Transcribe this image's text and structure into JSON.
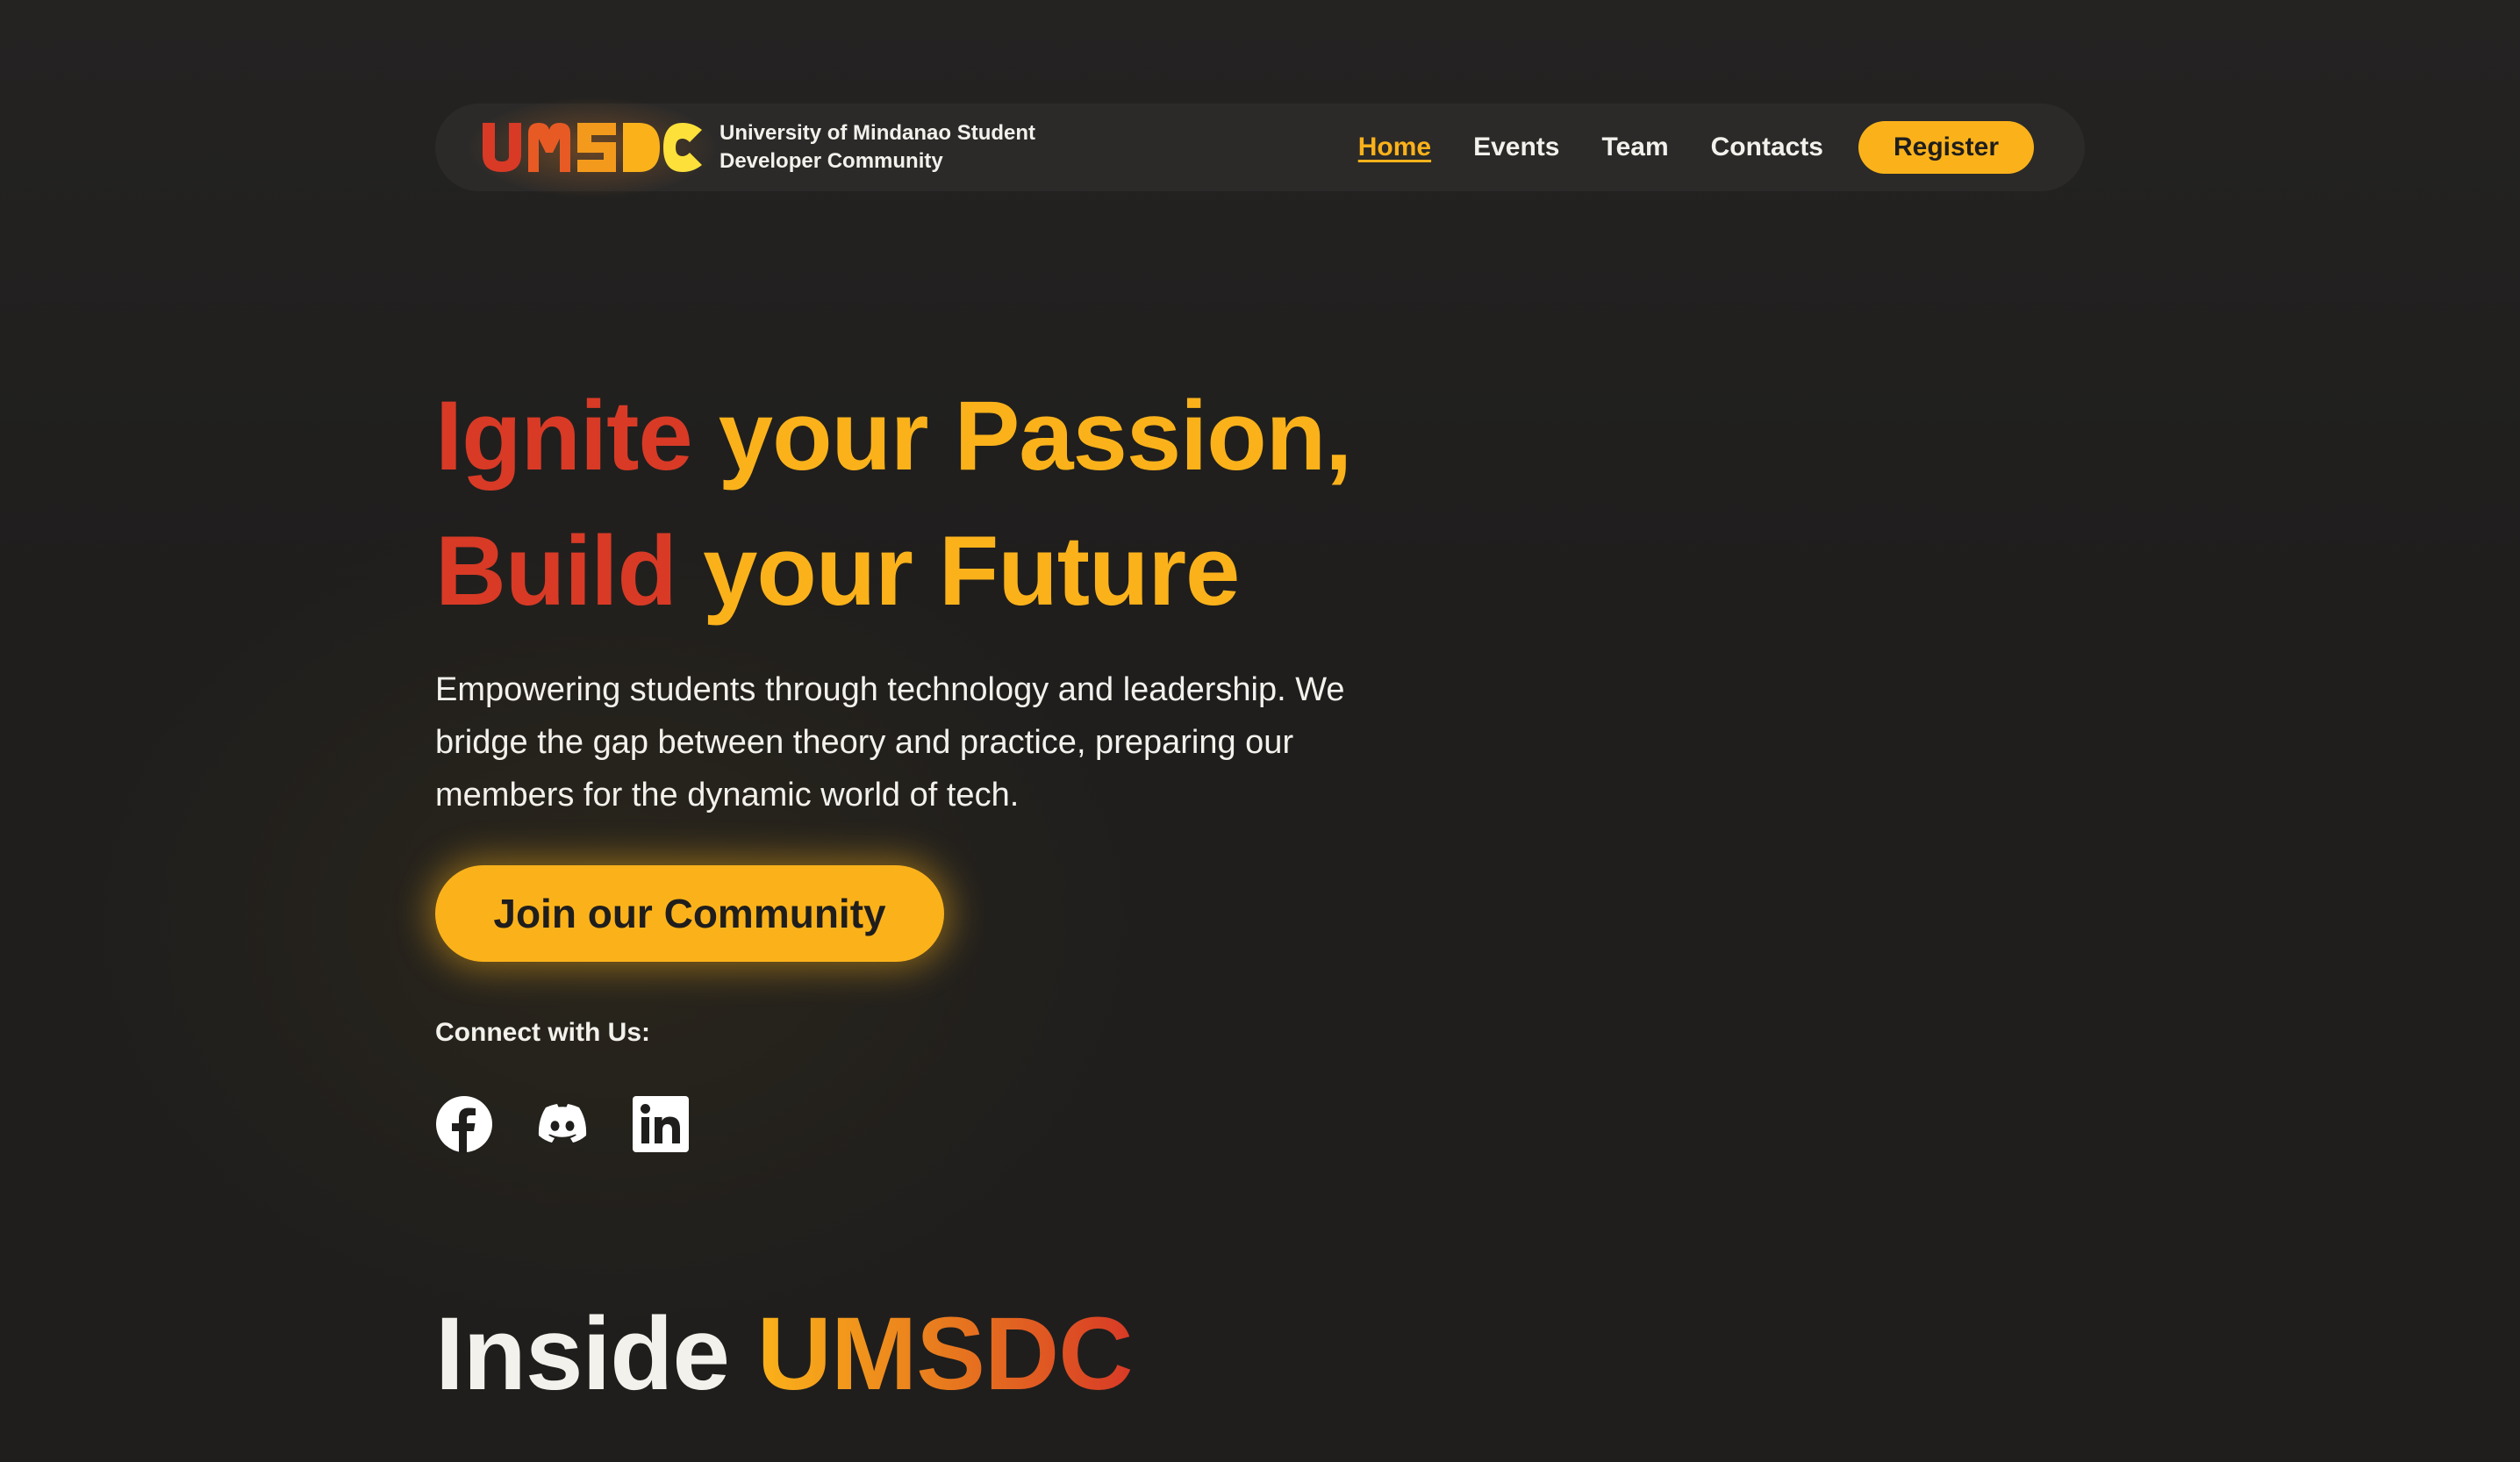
{
  "brand": {
    "logo_text": "UMSDC",
    "name": "University of Mindanao Student Developer Community"
  },
  "nav": {
    "items": [
      {
        "label": "Home",
        "active": true
      },
      {
        "label": "Events",
        "active": false
      },
      {
        "label": "Team",
        "active": false
      },
      {
        "label": "Contacts",
        "active": false
      }
    ],
    "register_label": "Register"
  },
  "hero": {
    "line1_red": "Ignite",
    "line1_yellow": "your Passion,",
    "line2_red": "Build",
    "line2_yellow": "your Future",
    "description": "Empowering students through technology and leadership. We bridge the gap between theory and practice, preparing our members for the dynamic world of tech.",
    "cta_label": "Join our Community",
    "connect_label": "Connect with Us:",
    "socials": [
      "facebook-icon",
      "discord-icon",
      "linkedin-icon"
    ]
  },
  "inside": {
    "prefix": "Inside",
    "highlight": "UMSDC"
  },
  "colors": {
    "background": "#1f1e1d",
    "accent_yellow": "#fbb21a",
    "accent_red": "#d83a26",
    "navbar": "#2b2a29"
  }
}
